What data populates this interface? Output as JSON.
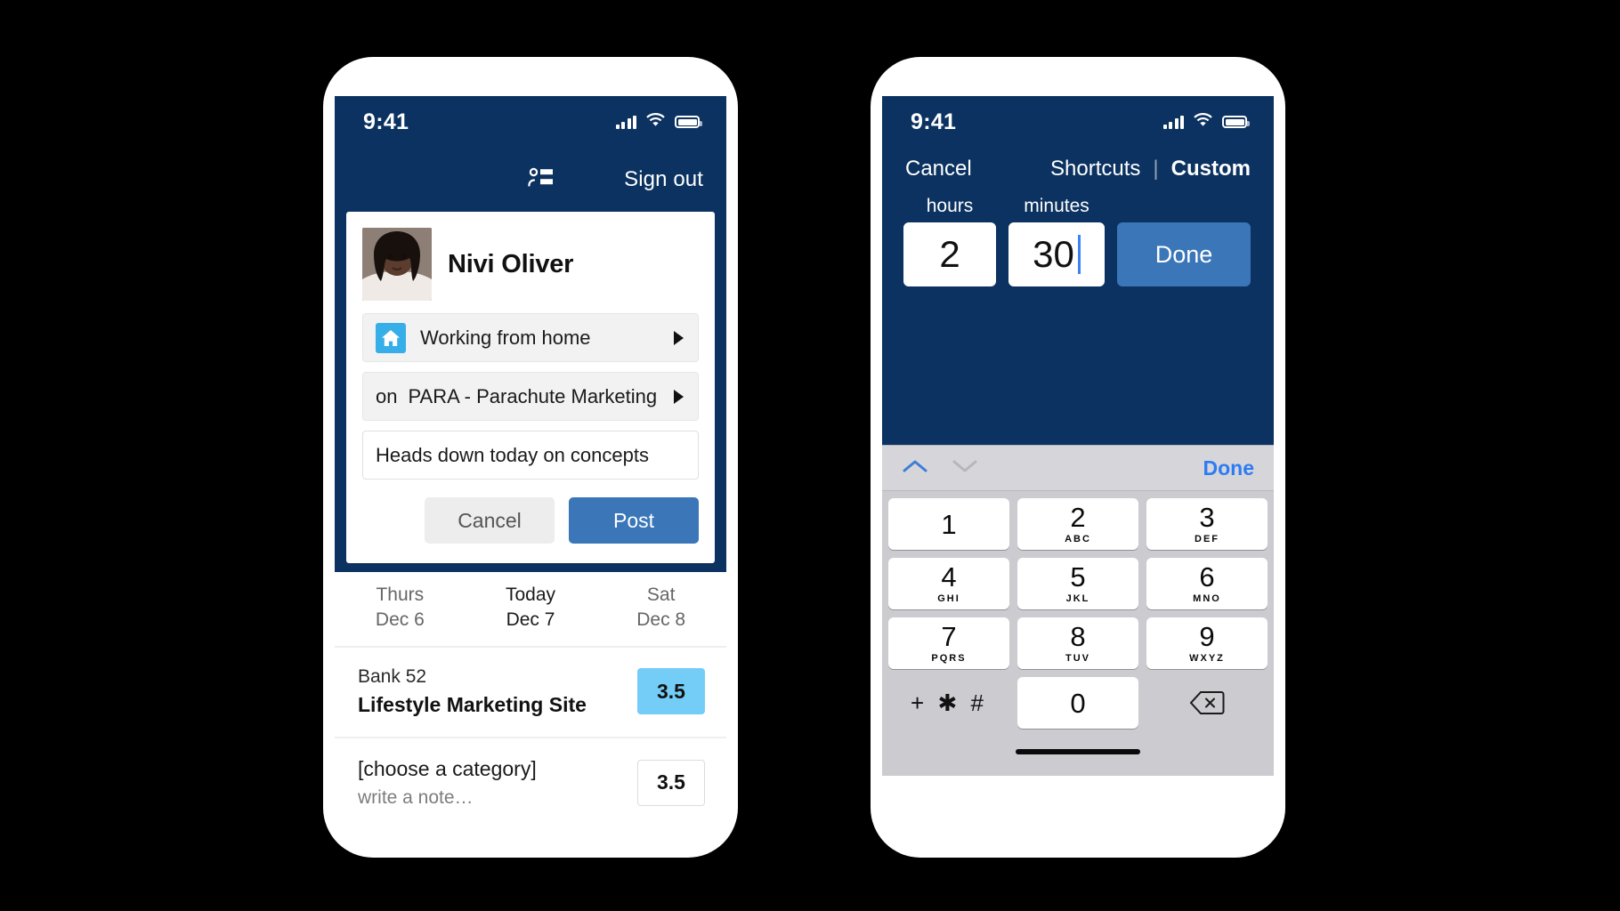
{
  "left_phone": {
    "status_bar": {
      "time": "9:41",
      "signal_icon": "cellular-bars-icon",
      "wifi_icon": "wifi-icon",
      "battery_icon": "battery-icon"
    },
    "nav": {
      "people_icon": "people-list-icon",
      "sign_out_label": "Sign out"
    },
    "compose": {
      "avatar_name": "avatar",
      "user_name": "Nivi Oliver",
      "status_field": {
        "icon": "home-icon",
        "value": "Working from home",
        "chevron": "chevron-right-icon"
      },
      "project_field": {
        "prefix": "on",
        "value": "PARA - Parachute Marketing",
        "chevron": "chevron-right-icon"
      },
      "note_field": {
        "value": "Heads down today on concepts",
        "placeholder": "write a note…"
      },
      "cancel_label": "Cancel",
      "post_label": "Post"
    },
    "days": [
      {
        "name": "Thurs",
        "date": "Dec 6",
        "today": false
      },
      {
        "name": "Today",
        "date": "Dec 7",
        "today": true
      },
      {
        "name": "Sat",
        "date": "Dec 8",
        "today": false
      }
    ],
    "entries": [
      {
        "line1": "Bank 52",
        "line2": "Lifestyle Marketing Site",
        "line2_muted": false,
        "amount": "3.5",
        "highlight": true
      },
      {
        "line1": "[choose a category]",
        "line2": "write a note…",
        "line2_muted": true,
        "amount": "3.5",
        "highlight": false
      }
    ]
  },
  "right_phone": {
    "status_bar": {
      "time": "9:41",
      "signal_icon": "cellular-bars-icon",
      "wifi_icon": "wifi-icon",
      "battery_icon": "battery-icon"
    },
    "nav": {
      "cancel_label": "Cancel",
      "shortcuts_label": "Shortcuts",
      "separator": "|",
      "custom_label": "Custom"
    },
    "time_entry": {
      "hours_label": "hours",
      "hours_value": "2",
      "minutes_label": "minutes",
      "minutes_value": "30",
      "done_label": "Done"
    },
    "keyboard": {
      "up_icon": "chevron-up-icon",
      "down_icon": "chevron-down-icon",
      "done_label": "Done",
      "keys": [
        [
          {
            "num": "1",
            "sub": ""
          },
          {
            "num": "2",
            "sub": "ABC"
          },
          {
            "num": "3",
            "sub": "DEF"
          }
        ],
        [
          {
            "num": "4",
            "sub": "GHI"
          },
          {
            "num": "5",
            "sub": "JKL"
          },
          {
            "num": "6",
            "sub": "MNO"
          }
        ],
        [
          {
            "num": "7",
            "sub": "PQRS"
          },
          {
            "num": "8",
            "sub": "TUV"
          },
          {
            "num": "9",
            "sub": "WXYZ"
          }
        ]
      ],
      "symbols_key": "+ ✱ #",
      "zero_key": "0",
      "delete_icon": "backspace-icon"
    }
  },
  "colors": {
    "navy": "#0b3260",
    "accent_blue": "#3a76b8",
    "light_blue": "#74cdf7",
    "home_icon_blue": "#36aee8",
    "keyboard_gray": "#cbcbd0",
    "link_blue": "#2d7bf4"
  }
}
